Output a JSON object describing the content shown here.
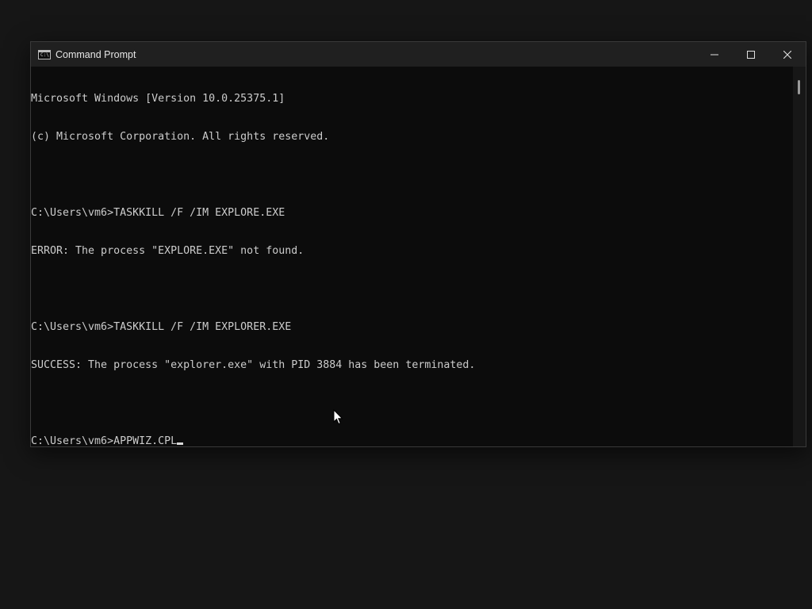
{
  "window": {
    "title": "Command Prompt",
    "icon": "cmd-icon"
  },
  "caption_buttons": {
    "minimize_icon": "minimize-icon",
    "maximize_icon": "maximize-icon",
    "close_icon": "close-icon"
  },
  "console": {
    "lines": [
      "Microsoft Windows [Version 10.0.25375.1]",
      "(c) Microsoft Corporation. All rights reserved.",
      "",
      "C:\\Users\\vm6>TASKKILL /F /IM EXPLORE.EXE",
      "ERROR: The process \"EXPLORE.EXE\" not found.",
      "",
      "C:\\Users\\vm6>TASKKILL /F /IM EXPLORER.EXE",
      "SUCCESS: The process \"explorer.exe\" with PID 3884 has been terminated.",
      ""
    ],
    "prompt": "C:\\Users\\vm6>",
    "current_input": "APPWIZ.CPL"
  },
  "colors": {
    "console_background": "#0c0c0c",
    "console_text": "#cccccc",
    "titlebar": "#202020",
    "desktop": "#161616"
  }
}
